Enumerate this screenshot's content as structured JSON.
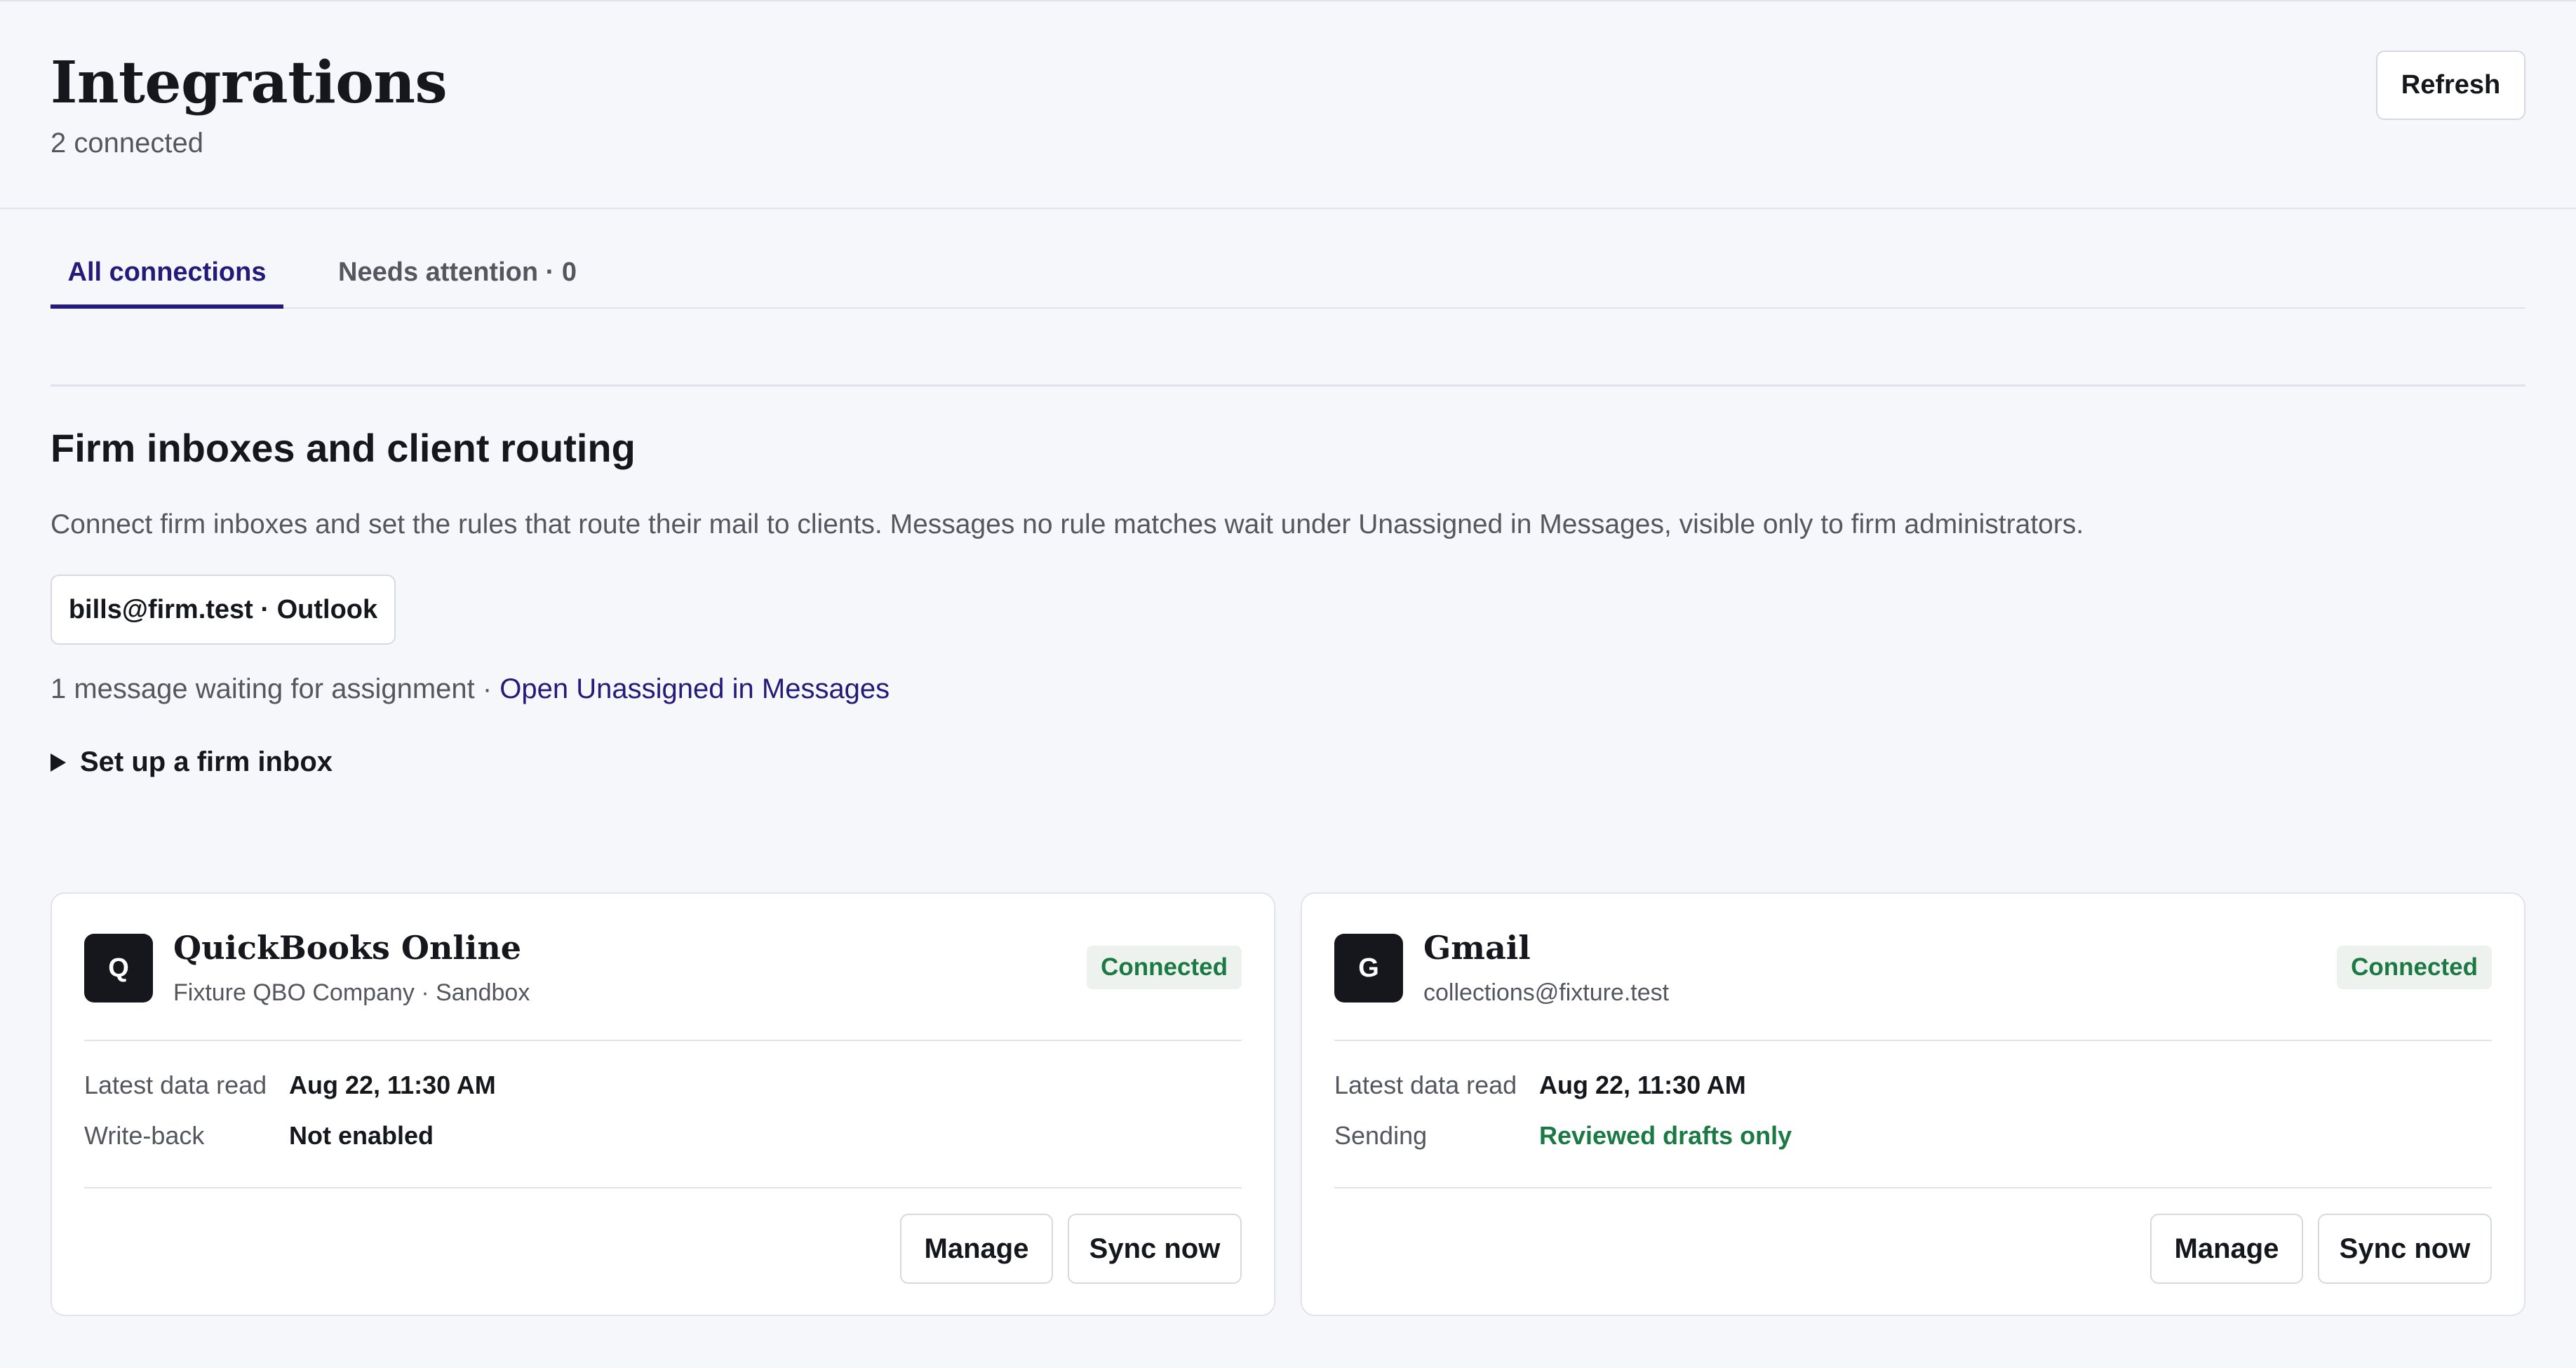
{
  "header": {
    "title": "Integrations",
    "subtitle": "2 connected",
    "refresh_label": "Refresh"
  },
  "tabs": [
    {
      "label": "All connections",
      "active": true
    },
    {
      "label": "Needs attention · 0",
      "active": false
    }
  ],
  "firm_inboxes": {
    "title": "Firm inboxes and client routing",
    "description": "Connect firm inboxes and set the rules that route their mail to clients. Messages no rule matches wait under Unassigned in Messages, visible only to firm administrators.",
    "inbox_chip": "bills@firm.test · Outlook",
    "waiting_text": "1 message waiting for assignment · ",
    "waiting_link": "Open Unassigned in Messages",
    "setup_label": "Set up a firm inbox"
  },
  "integrations": [
    {
      "logo_letter": "Q",
      "name": "QuickBooks Online",
      "meta": "Fixture QBO Company · Sandbox",
      "status": "Connected",
      "row1_label": "Latest data read",
      "row1_value": "Aug 22, 11:30 AM",
      "row2_label": "Write-back",
      "row2_value": "Not enabled",
      "manage_label": "Manage",
      "sync_label": "Sync now"
    },
    {
      "logo_letter": "G",
      "name": "Gmail",
      "meta": "collections@fixture.test",
      "status": "Connected",
      "row1_label": "Latest data read",
      "row1_value": "Aug 22, 11:30 AM",
      "row2_label": "Sending",
      "row2_value": "Reviewed drafts only",
      "manage_label": "Manage",
      "sync_label": "Sync now"
    }
  ],
  "colors": {
    "accent": "#231a7a",
    "status_green": "#1b7a43",
    "background": "#f6f7fa"
  },
  "icons": {
    "setup_toggle": "disclosure-triangle-icon"
  }
}
